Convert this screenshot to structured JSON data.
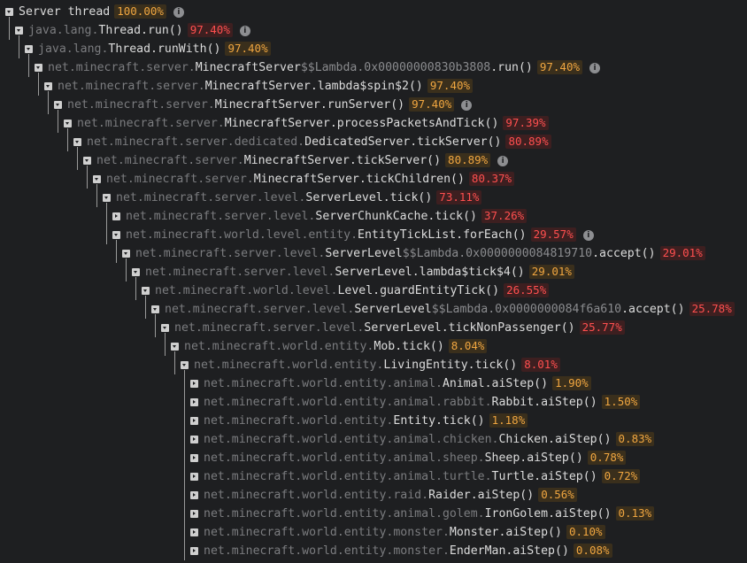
{
  "rows": [
    {
      "depth": 0,
      "pkg": "",
      "cls": "Server thread",
      "dollar": "",
      "suffix": "",
      "meth": "",
      "pct": "100.00%",
      "color": "orange",
      "info": true,
      "collapsed": false
    },
    {
      "depth": 1,
      "pkg": "java.lang.",
      "cls": "Thread",
      "dollar": "",
      "suffix": "",
      "meth": ".run()",
      "pct": "97.40%",
      "color": "red",
      "info": true,
      "collapsed": false
    },
    {
      "depth": 2,
      "pkg": "java.lang.",
      "cls": "Thread",
      "dollar": "",
      "suffix": "",
      "meth": ".runWith()",
      "pct": "97.40%",
      "color": "orange",
      "info": false,
      "collapsed": false
    },
    {
      "depth": 3,
      "pkg": "net.minecraft.server.",
      "cls": "MinecraftServer",
      "dollar": "$$",
      "suffix": "Lambda.0x00000000830b3808",
      "meth": ".run()",
      "pct": "97.40%",
      "color": "orange",
      "info": true,
      "collapsed": false
    },
    {
      "depth": 4,
      "pkg": "net.minecraft.server.",
      "cls": "MinecraftServer",
      "dollar": "",
      "suffix": "",
      "meth": ".lambda$spin$2()",
      "pct": "97.40%",
      "color": "orange",
      "info": false,
      "collapsed": false
    },
    {
      "depth": 5,
      "pkg": "net.minecraft.server.",
      "cls": "MinecraftServer",
      "dollar": "",
      "suffix": "",
      "meth": ".runServer()",
      "pct": "97.40%",
      "color": "orange",
      "info": true,
      "collapsed": false
    },
    {
      "depth": 6,
      "pkg": "net.minecraft.server.",
      "cls": "MinecraftServer",
      "dollar": "",
      "suffix": "",
      "meth": ".processPacketsAndTick()",
      "pct": "97.39%",
      "color": "red",
      "info": false,
      "collapsed": false
    },
    {
      "depth": 7,
      "pkg": "net.minecraft.server.dedicated.",
      "cls": "DedicatedServer",
      "dollar": "",
      "suffix": "",
      "meth": ".tickServer()",
      "pct": "80.89%",
      "color": "red",
      "info": false,
      "collapsed": false
    },
    {
      "depth": 8,
      "pkg": "net.minecraft.server.",
      "cls": "MinecraftServer",
      "dollar": "",
      "suffix": "",
      "meth": ".tickServer()",
      "pct": "80.89%",
      "color": "orange",
      "info": true,
      "collapsed": false
    },
    {
      "depth": 9,
      "pkg": "net.minecraft.server.",
      "cls": "MinecraftServer",
      "dollar": "",
      "suffix": "",
      "meth": ".tickChildren()",
      "pct": "80.37%",
      "color": "red",
      "info": false,
      "collapsed": false
    },
    {
      "depth": 10,
      "pkg": "net.minecraft.server.level.",
      "cls": "ServerLevel",
      "dollar": "",
      "suffix": "",
      "meth": ".tick()",
      "pct": "73.11%",
      "color": "red",
      "info": false,
      "collapsed": false
    },
    {
      "depth": 11,
      "pkg": "net.minecraft.server.level.",
      "cls": "ServerChunkCache",
      "dollar": "",
      "suffix": "",
      "meth": ".tick()",
      "pct": "37.26%",
      "color": "red",
      "info": false,
      "collapsed": true
    },
    {
      "depth": 11,
      "pkg": "net.minecraft.world.level.entity.",
      "cls": "EntityTickList",
      "dollar": "",
      "suffix": "",
      "meth": ".forEach()",
      "pct": "29.57%",
      "color": "red",
      "info": true,
      "collapsed": false
    },
    {
      "depth": 12,
      "pkg": "net.minecraft.server.level.",
      "cls": "ServerLevel",
      "dollar": "$$",
      "suffix": "Lambda.0x0000000084819710",
      "meth": ".accept()",
      "pct": "29.01%",
      "color": "red",
      "info": false,
      "collapsed": false
    },
    {
      "depth": 13,
      "pkg": "net.minecraft.server.level.",
      "cls": "ServerLevel",
      "dollar": "",
      "suffix": "",
      "meth": ".lambda$tick$4()",
      "pct": "29.01%",
      "color": "orange",
      "info": false,
      "collapsed": false
    },
    {
      "depth": 14,
      "pkg": "net.minecraft.world.level.",
      "cls": "Level",
      "dollar": "",
      "suffix": "",
      "meth": ".guardEntityTick()",
      "pct": "26.55%",
      "color": "red",
      "info": false,
      "collapsed": false
    },
    {
      "depth": 15,
      "pkg": "net.minecraft.server.level.",
      "cls": "ServerLevel",
      "dollar": "$$",
      "suffix": "Lambda.0x0000000084f6a610",
      "meth": ".accept()",
      "pct": "25.78%",
      "color": "red",
      "info": false,
      "collapsed": false
    },
    {
      "depth": 16,
      "pkg": "net.minecraft.server.level.",
      "cls": "ServerLevel",
      "dollar": "",
      "suffix": "",
      "meth": ".tickNonPassenger()",
      "pct": "25.77%",
      "color": "red",
      "info": false,
      "collapsed": false
    },
    {
      "depth": 17,
      "pkg": "net.minecraft.world.entity.",
      "cls": "Mob",
      "dollar": "",
      "suffix": "",
      "meth": ".tick()",
      "pct": "8.04%",
      "color": "orange",
      "info": false,
      "collapsed": false
    },
    {
      "depth": 18,
      "pkg": "net.minecraft.world.entity.",
      "cls": "LivingEntity",
      "dollar": "",
      "suffix": "",
      "meth": ".tick()",
      "pct": "8.01%",
      "color": "red",
      "info": false,
      "collapsed": false
    },
    {
      "depth": 19,
      "pkg": "net.minecraft.world.entity.animal.",
      "cls": "Animal",
      "dollar": "",
      "suffix": "",
      "meth": ".aiStep()",
      "pct": "1.90%",
      "color": "orange",
      "info": false,
      "collapsed": true
    },
    {
      "depth": 19,
      "pkg": "net.minecraft.world.entity.animal.rabbit.",
      "cls": "Rabbit",
      "dollar": "",
      "suffix": "",
      "meth": ".aiStep()",
      "pct": "1.50%",
      "color": "orange",
      "info": false,
      "collapsed": true
    },
    {
      "depth": 19,
      "pkg": "net.minecraft.world.entity.",
      "cls": "Entity",
      "dollar": "",
      "suffix": "",
      "meth": ".tick()",
      "pct": "1.18%",
      "color": "orange",
      "info": false,
      "collapsed": true
    },
    {
      "depth": 19,
      "pkg": "net.minecraft.world.entity.animal.chicken.",
      "cls": "Chicken",
      "dollar": "",
      "suffix": "",
      "meth": ".aiStep()",
      "pct": "0.83%",
      "color": "orange",
      "info": false,
      "collapsed": true
    },
    {
      "depth": 19,
      "pkg": "net.minecraft.world.entity.animal.sheep.",
      "cls": "Sheep",
      "dollar": "",
      "suffix": "",
      "meth": ".aiStep()",
      "pct": "0.78%",
      "color": "orange",
      "info": false,
      "collapsed": true
    },
    {
      "depth": 19,
      "pkg": "net.minecraft.world.entity.animal.turtle.",
      "cls": "Turtle",
      "dollar": "",
      "suffix": "",
      "meth": ".aiStep()",
      "pct": "0.72%",
      "color": "orange",
      "info": false,
      "collapsed": true
    },
    {
      "depth": 19,
      "pkg": "net.minecraft.world.entity.raid.",
      "cls": "Raider",
      "dollar": "",
      "suffix": "",
      "meth": ".aiStep()",
      "pct": "0.56%",
      "color": "orange",
      "info": false,
      "collapsed": true
    },
    {
      "depth": 19,
      "pkg": "net.minecraft.world.entity.animal.golem.",
      "cls": "IronGolem",
      "dollar": "",
      "suffix": "",
      "meth": ".aiStep()",
      "pct": "0.13%",
      "color": "orange",
      "info": false,
      "collapsed": true
    },
    {
      "depth": 19,
      "pkg": "net.minecraft.world.entity.monster.",
      "cls": "Monster",
      "dollar": "",
      "suffix": "",
      "meth": ".aiStep()",
      "pct": "0.10%",
      "color": "orange",
      "info": false,
      "collapsed": true
    },
    {
      "depth": 19,
      "pkg": "net.minecraft.world.entity.monster.",
      "cls": "EnderMan",
      "dollar": "",
      "suffix": "",
      "meth": ".aiStep()",
      "pct": "0.08%",
      "color": "orange",
      "info": false,
      "collapsed": true
    }
  ]
}
